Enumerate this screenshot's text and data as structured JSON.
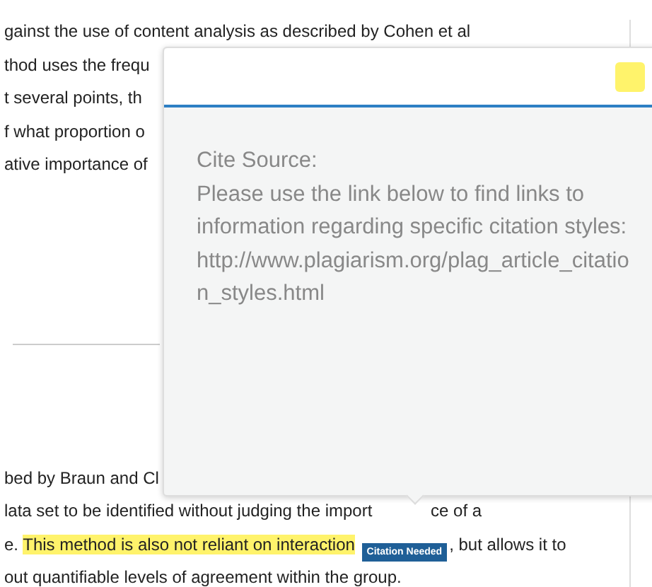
{
  "document": {
    "top_lines": [
      [
        {
          "text": "gainst the use of content analysis as described by Cohen et al",
          "highlighted": false
        }
      ],
      [
        {
          "text": "thod uses the frequ",
          "highlighted": false
        }
      ],
      [
        {
          "text": "t several points, th",
          "highlighted": false
        }
      ],
      [
        {
          "text": "f what proportion o",
          "highlighted": false
        }
      ],
      [
        {
          "text": "ative importance of",
          "highlighted": false
        }
      ]
    ],
    "bottom_lines": [
      [
        {
          "text": "bed by Braun and Cl",
          "highlighted": false
        }
      ],
      [
        {
          "text": "lata set to be identified without judging the import",
          "highlighted": false
        },
        {
          "text": "ce of a",
          "highlighted": false
        }
      ],
      [
        {
          "text": "e. ",
          "highlighted": false
        },
        {
          "text": "This method is also not reliant on interaction",
          "highlighted": true
        },
        {
          "text": ", but allows it to",
          "highlighted": false
        }
      ],
      [
        {
          "text": "out quantifiable levels of agreement within the group.",
          "highlighted": false
        }
      ]
    ],
    "badge": {
      "label": "Citation Needed"
    }
  },
  "popup": {
    "title": "Cite Source:",
    "text": "Please use the link below to find links to information regarding specific citation styles:",
    "url": "http://www.plagiarism.org/plag_article_citation_styles.html",
    "color": "#fff36b"
  }
}
